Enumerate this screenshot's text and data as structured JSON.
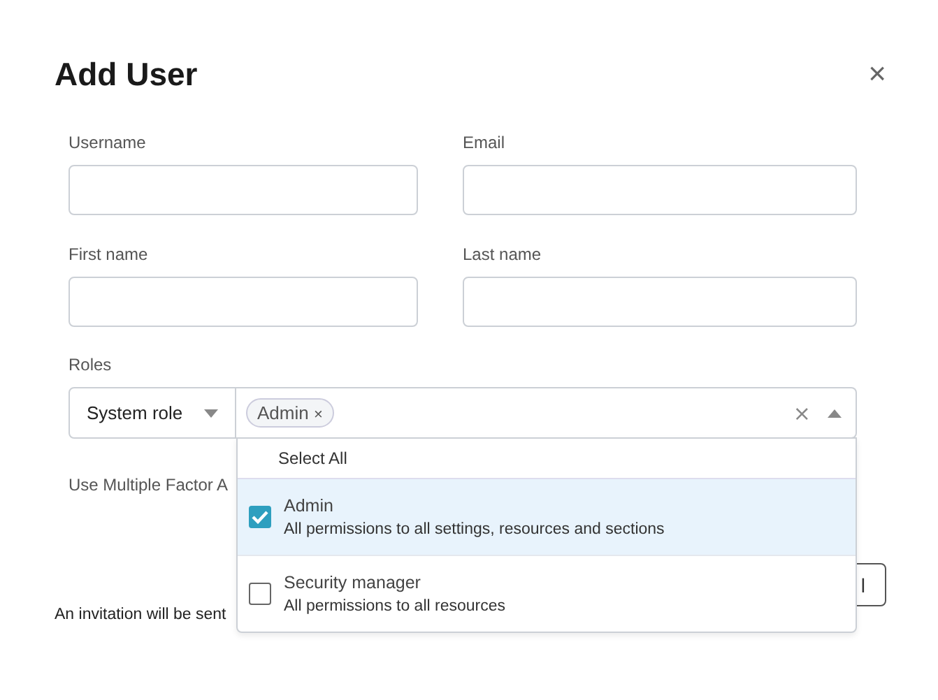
{
  "dialog": {
    "title": "Add User",
    "close": "×"
  },
  "fields": [
    {
      "label": "Username"
    },
    {
      "label": "Email"
    },
    {
      "label": "First name"
    },
    {
      "label": "Last name"
    }
  ],
  "roles": {
    "label": "Roles",
    "type_select": "System role",
    "chips": [
      {
        "label": "Admin",
        "remove": "×"
      }
    ],
    "clear": "×",
    "dropdown": {
      "select_all": "Select All",
      "options": [
        {
          "title": "Admin",
          "description": "All permissions to all settings, resources and sections",
          "checked": true
        },
        {
          "title": "Security manager",
          "description": "All permissions to all resources",
          "checked": false
        }
      ]
    }
  },
  "mfa_label": "Use Multiple Factor A",
  "button_fragment": "l",
  "note": "An invitation will be sent"
}
